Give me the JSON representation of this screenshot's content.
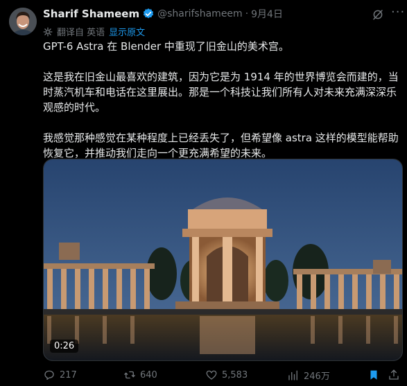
{
  "author": {
    "name": "Sharif Shameem",
    "handle": "@sharifshameem",
    "separator": "·",
    "date": "9月4日"
  },
  "translation": {
    "label": "翻译自 英语",
    "show_original": "显示原文"
  },
  "tweet": {
    "text": "GPT-6 Astra 在 Blender 中重现了旧金山的美术宫。\n\n这是我在旧金山最喜欢的建筑，因为它是为 1914 年的世界博览会而建的，当时蒸汽机车和电话在这里展出。那是一个科技让我们所有人对未来充满深深乐观感的时代。\n\n我感觉那种感觉在某种程度上已经丢失了，但希望像 astra 这样的模型能帮助恢复它，并推动我们走向一个更充满希望的未来。"
  },
  "media": {
    "duration": "0:26"
  },
  "actions": {
    "replies": "217",
    "reposts": "640",
    "likes": "5,583",
    "views": "246万"
  },
  "colors": {
    "accent": "#1d9bf0",
    "muted": "#71767b",
    "text": "#e7e9ea",
    "background": "#000000"
  }
}
